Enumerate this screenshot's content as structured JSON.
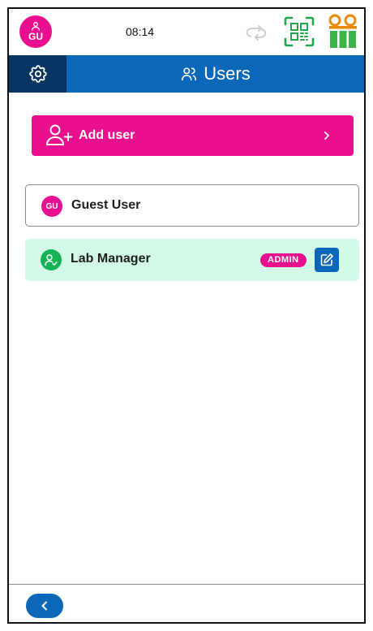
{
  "status_bar": {
    "avatar_initials": "GU",
    "time": "08:14",
    "icons": [
      "person-icon",
      "sync-icon",
      "qr-code-icon",
      "rack-icon"
    ]
  },
  "header": {
    "title": "Users",
    "icons": [
      "gear-icon",
      "users-icon"
    ]
  },
  "add_user": {
    "label": "Add user",
    "icons": [
      "add-person-icon",
      "chevron-right-icon"
    ]
  },
  "users": [
    {
      "initials": "GU",
      "name": "Guest User"
    },
    {
      "name": "Lab Manager",
      "badge": "ADMIN",
      "icons": [
        "person-check-icon",
        "edit-icon"
      ]
    }
  ],
  "footer": {
    "icons": [
      "chevron-left-icon"
    ]
  },
  "colors": {
    "magenta": "#ea0f8e",
    "blue": "#0b67b7",
    "dark_blue": "#0a3563",
    "green": "#16b257",
    "light_green": "#d3fae6",
    "qr_green": "#1fa64a",
    "rack_orange": "#e98a0c",
    "rack_green": "#3ab54a"
  }
}
